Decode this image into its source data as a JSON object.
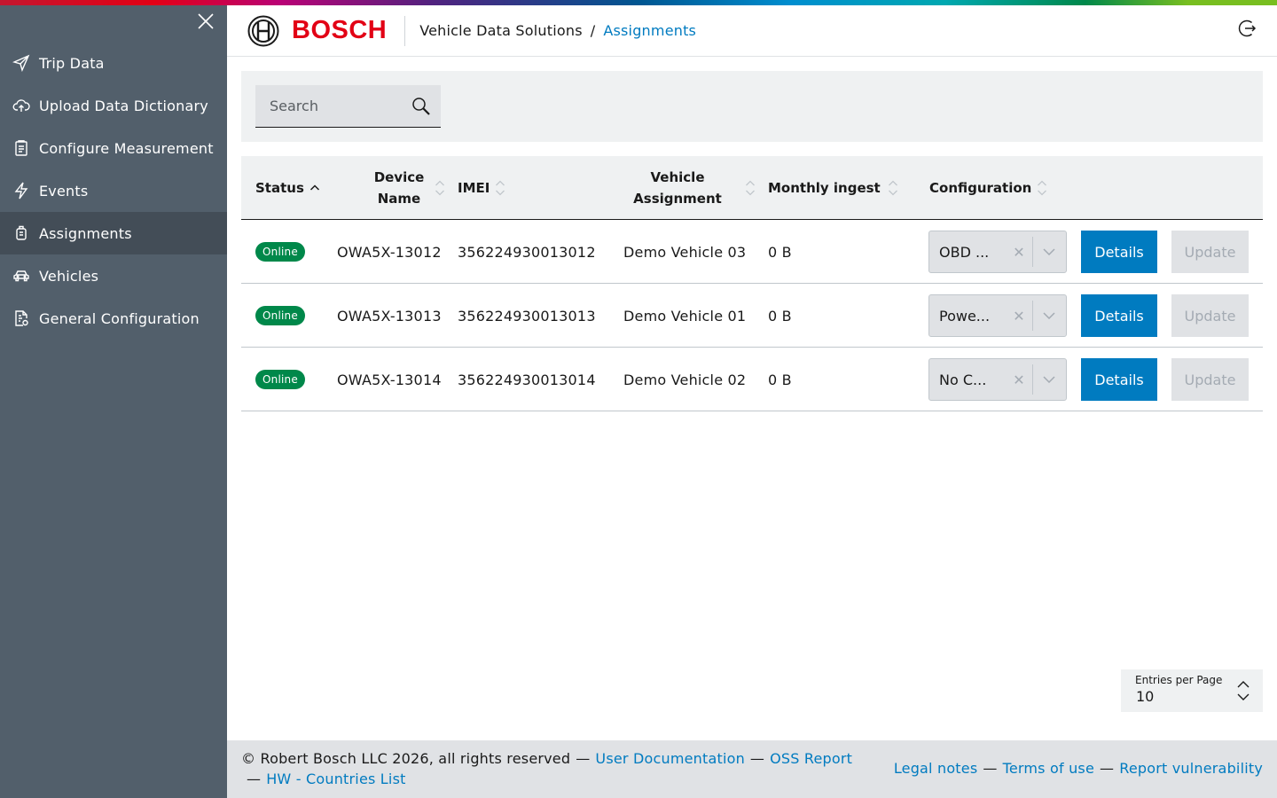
{
  "brand": {
    "wordmark": "BOSCH",
    "color": "#e20015"
  },
  "breadcrumb": {
    "app": "Vehicle Data Solutions",
    "separator": "/",
    "current": "Assignments"
  },
  "sidebar": {
    "items": [
      {
        "label": "Trip Data",
        "icon": "paper-plane-icon"
      },
      {
        "label": "Upload Data Dictionary",
        "icon": "cloud-upload-icon"
      },
      {
        "label": "Configure Measurement",
        "icon": "clipboard-icon"
      },
      {
        "label": "Events",
        "icon": "lightning-icon"
      },
      {
        "label": "Assignments",
        "icon": "device-icon",
        "active": true
      },
      {
        "label": "Vehicles",
        "icon": "car-icon"
      },
      {
        "label": "General Configuration",
        "icon": "document-settings-icon"
      }
    ]
  },
  "search": {
    "placeholder": "Search"
  },
  "table": {
    "headers": {
      "status": "Status",
      "device_name": "Device\nName",
      "imei": "IMEI",
      "vehicle_assignment": "Vehicle\nAssignment",
      "monthly_ingest": "Monthly ingest",
      "configuration": "Configuration"
    },
    "rows": [
      {
        "status": "Online",
        "device_name": "OWA5X-13012",
        "imei": "356224930013012",
        "vehicle": "Demo Vehicle 03",
        "ingest": "0 B",
        "configuration": "OBD ...",
        "details": "Details",
        "update": "Update"
      },
      {
        "status": "Online",
        "device_name": "OWA5X-13013",
        "imei": "356224930013013",
        "vehicle": "Demo Vehicle 01",
        "ingest": "0 B",
        "configuration": "Powe...",
        "details": "Details",
        "update": "Update"
      },
      {
        "status": "Online",
        "device_name": "OWA5X-13014",
        "imei": "356224930013014",
        "vehicle": "Demo Vehicle 02",
        "ingest": "0 B",
        "configuration": "No C...",
        "details": "Details",
        "update": "Update"
      }
    ]
  },
  "pagination": {
    "label": "Entries per Page",
    "value": "10"
  },
  "footer": {
    "copyright": "© Robert Bosch LLC 2026, all rights reserved",
    "user_docs": "User Documentation",
    "oss_report": "OSS Report",
    "hw_countries": "HW - Countries List",
    "legal": "Legal notes",
    "terms": "Terms of use",
    "vulnerability": "Report vulnerability",
    "dash": "—"
  },
  "colors": {
    "primary": "#007bc0",
    "online": "#00884a",
    "sidebar": "#525f6b",
    "sidebar_active": "#434d57"
  }
}
